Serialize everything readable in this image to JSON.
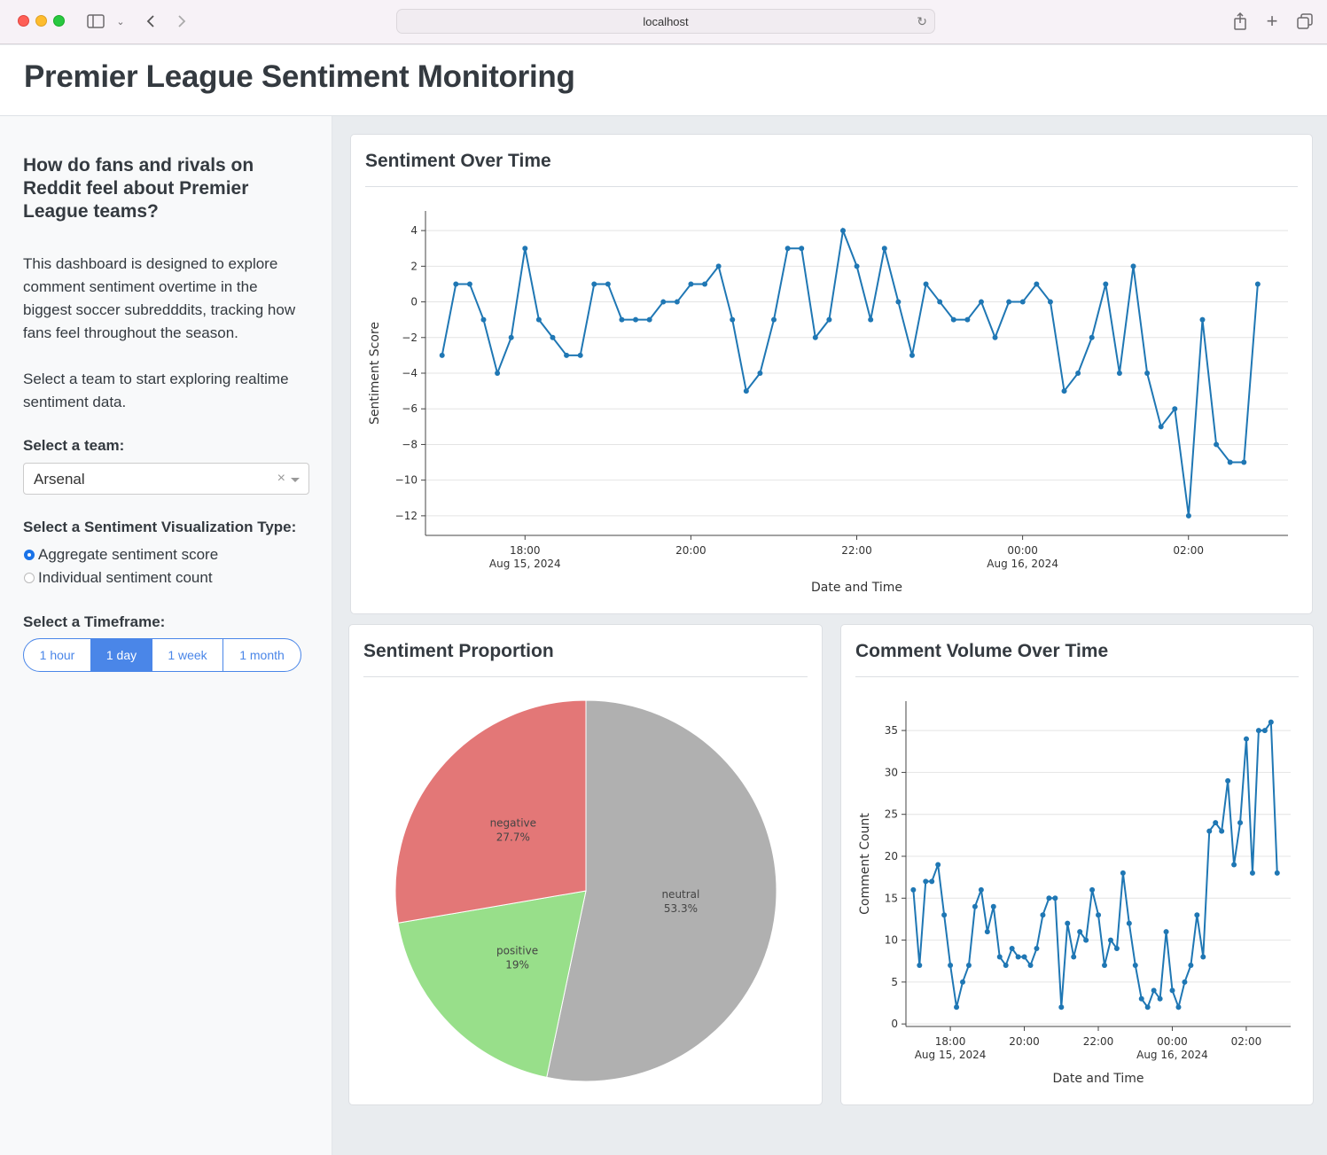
{
  "browser": {
    "url": "localhost"
  },
  "header": {
    "title": "Premier League Sentiment Monitoring"
  },
  "sidebar": {
    "question": "How do fans and rivals on Reddit feel about Premier League teams?",
    "description": "This dashboard is designed to explore comment sentiment overtime in the biggest soccer subredddits, tracking how fans feel throughout the season.",
    "instruction": "Select a team to start exploring realtime sentiment data.",
    "team_label": "Select a team:",
    "team_value": "Arsenal",
    "viz_label": "Select a Sentiment Visualization Type:",
    "viz_options": [
      "Aggregate sentiment score",
      "Individual sentiment count"
    ],
    "viz_selected": 0,
    "timeframe_label": "Select a Timeframe:",
    "timeframes": [
      "1 hour",
      "1 day",
      "1 week",
      "1 month"
    ],
    "timeframe_selected": 1
  },
  "cards": {
    "sentiment_title": "Sentiment Over Time",
    "proportion_title": "Sentiment Proportion",
    "volume_title": "Comment Volume Over Time"
  },
  "chart_data": [
    {
      "type": "line",
      "title": "",
      "xlabel": "Date and Time",
      "ylabel": "Sentiment Score",
      "x_range_hours": [
        16.8,
        27.2
      ],
      "x_ticks": [
        {
          "h": 18,
          "line1": "18:00",
          "line2": "Aug 15, 2024"
        },
        {
          "h": 20,
          "line1": "20:00",
          "line2": ""
        },
        {
          "h": 22,
          "line1": "22:00",
          "line2": ""
        },
        {
          "h": 24,
          "line1": "00:00",
          "line2": "Aug 16, 2024"
        },
        {
          "h": 26,
          "line1": "02:00",
          "line2": ""
        }
      ],
      "y_ticks": [
        4,
        2,
        0,
        -2,
        -4,
        -6,
        -8,
        -10,
        -12
      ],
      "y_tick_labels": [
        "4",
        "2",
        "0",
        "−2",
        "−4",
        "−6",
        "−8",
        "−10",
        "−12"
      ],
      "ylim": [
        -13.1,
        5.1
      ],
      "x_start_hour": 17.0,
      "x_step_hours": 0.1667,
      "values": [
        -3,
        1,
        1,
        -1,
        -4,
        -2,
        3,
        -1,
        -2,
        -3,
        -3,
        1,
        1,
        -1,
        -1,
        -1,
        0,
        0,
        1,
        1,
        2,
        -1,
        -5,
        -4,
        -1,
        3,
        3,
        -2,
        -1,
        4,
        2,
        -1,
        3,
        0,
        -3,
        1,
        0,
        -1,
        -1,
        0,
        -2,
        0,
        0,
        1,
        0,
        -5,
        -4,
        -2,
        1,
        -4,
        2,
        -4,
        -7,
        -6,
        -12,
        -1,
        -8,
        -9,
        -9,
        1
      ],
      "color": "#1f77b4"
    },
    {
      "type": "pie",
      "title": "",
      "slices": [
        {
          "label": "neutral",
          "value": 53.3,
          "pct": "53.3%",
          "color": "#b0b0b0"
        },
        {
          "label": "positive",
          "value": 19,
          "pct": "19%",
          "color": "#98df8a"
        },
        {
          "label": "negative",
          "value": 27.7,
          "pct": "27.7%",
          "color": "#e37777"
        }
      ]
    },
    {
      "type": "line",
      "title": "",
      "xlabel": "Date and Time",
      "ylabel": "Comment Count",
      "x_range_hours": [
        16.8,
        27.2
      ],
      "x_ticks": [
        {
          "h": 18,
          "line1": "18:00",
          "line2": "Aug 15, 2024"
        },
        {
          "h": 20,
          "line1": "20:00",
          "line2": ""
        },
        {
          "h": 22,
          "line1": "22:00",
          "line2": ""
        },
        {
          "h": 24,
          "line1": "00:00",
          "line2": "Aug 16, 2024"
        },
        {
          "h": 26,
          "line1": "02:00",
          "line2": ""
        }
      ],
      "y_ticks": [
        0,
        5,
        10,
        15,
        20,
        25,
        30,
        35
      ],
      "y_tick_labels": [
        "0",
        "5",
        "10",
        "15",
        "20",
        "25",
        "30",
        "35"
      ],
      "ylim": [
        -0.3,
        38.5
      ],
      "x_start_hour": 17.0,
      "x_step_hours": 0.1667,
      "values": [
        16,
        7,
        17,
        17,
        19,
        13,
        7,
        2,
        5,
        7,
        14,
        16,
        11,
        14,
        8,
        7,
        9,
        8,
        8,
        7,
        9,
        13,
        15,
        15,
        2,
        12,
        8,
        11,
        10,
        16,
        13,
        7,
        10,
        9,
        18,
        12,
        7,
        3,
        2,
        4,
        3,
        11,
        4,
        2,
        5,
        7,
        13,
        8,
        23,
        24,
        23,
        29,
        19,
        24,
        34,
        18,
        35,
        35,
        36,
        18
      ],
      "color": "#1f77b4"
    }
  ]
}
